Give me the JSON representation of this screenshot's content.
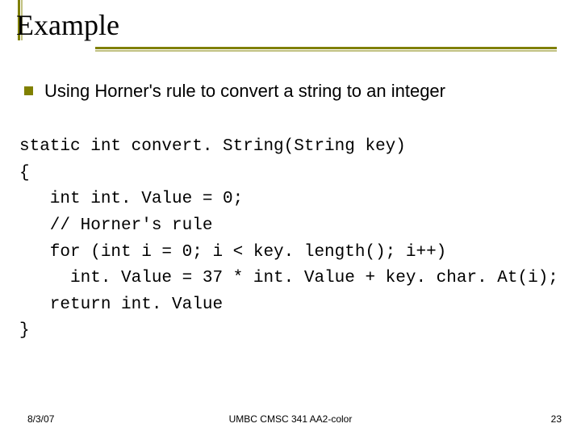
{
  "title": "Example",
  "bullet": "Using Horner's rule to convert a string to an integer",
  "code": {
    "l1": "static int convert. String(String key)",
    "l2": "{",
    "l3": "   int int. Value = 0;",
    "l4": "   // Horner's rule",
    "l5": "   for (int i = 0; i < key. length(); i++)",
    "l6": "     int. Value = 37 * int. Value + key. char. At(i);",
    "l7": "   return int. Value",
    "l8": "}"
  },
  "footer": {
    "date": "8/3/07",
    "center": "UMBC CMSC 341 AA2-color",
    "page": "23"
  }
}
